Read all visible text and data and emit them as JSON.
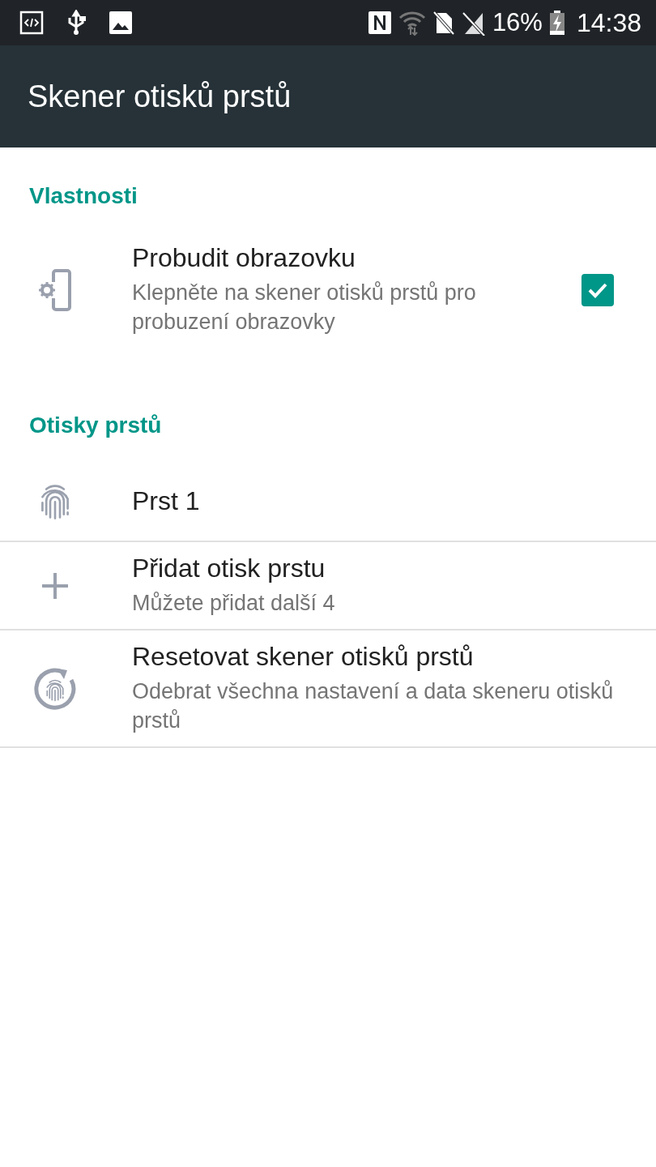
{
  "status_bar": {
    "battery": "16%",
    "time": "14:38"
  },
  "toolbar": {
    "title": "Skener otisků prstů"
  },
  "sections": [
    {
      "title": "Vlastnosti",
      "items": [
        {
          "kind": "wake",
          "title": "Probudit obrazovku",
          "subtitle": "Klepněte na skener otisků prstů pro probuzení obrazovky",
          "checked": true
        }
      ]
    },
    {
      "title": "Otisky prstů",
      "items": [
        {
          "kind": "fingerprint",
          "title": "Prst 1"
        },
        {
          "kind": "add",
          "title": "Přidat otisk prstu",
          "subtitle": "Můžete přidat další 4"
        },
        {
          "kind": "reset",
          "title": "Resetovat skener otisků prstů",
          "subtitle": "Odebrat všechna nastavení a data skeneru otisků prstů"
        }
      ]
    }
  ]
}
